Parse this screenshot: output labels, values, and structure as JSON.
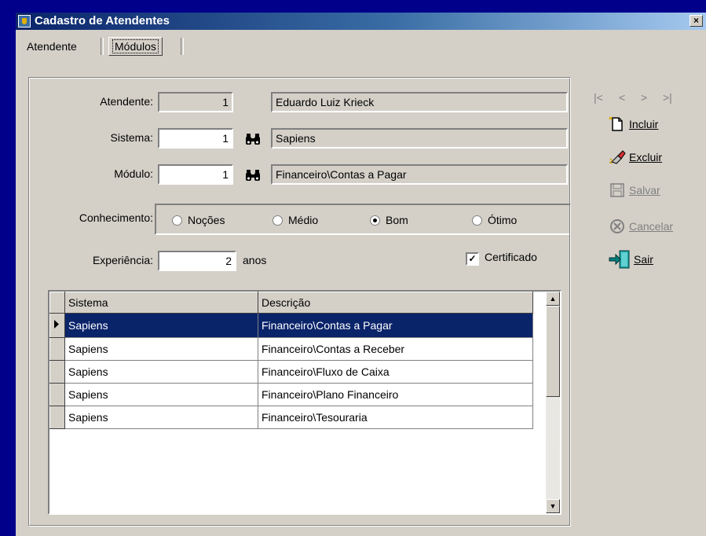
{
  "window": {
    "title": "Cadastro de Atendentes",
    "close_glyph": "×"
  },
  "tabs": [
    {
      "label": "Atendente",
      "active": false
    },
    {
      "label": "Módulos",
      "active": true
    }
  ],
  "form": {
    "atendente_label": "Atendente:",
    "atendente_code": "1",
    "atendente_name": "Eduardo Luiz Krieck",
    "sistema_label": "Sistema:",
    "sistema_code": "1",
    "sistema_name": "Sapiens",
    "modulo_label": "Módulo:",
    "modulo_code": "1",
    "modulo_name": "Financeiro\\Contas a Pagar",
    "conhecimento_label": "Conhecimento:",
    "conhecimento_options": [
      "Noções",
      "Médio",
      "Bom",
      "Ótimo"
    ],
    "conhecimento_selected": "Bom",
    "experiencia_label": "Experiência:",
    "experiencia_value": "2",
    "experiencia_unit": "anos",
    "certificado_label": "Certificado",
    "certificado_checked": true
  },
  "grid": {
    "headers": [
      "Sistema",
      "Descrição"
    ],
    "rows": [
      {
        "sistema": "Sapiens",
        "descricao": "Financeiro\\Contas a Pagar",
        "selected": true
      },
      {
        "sistema": "Sapiens",
        "descricao": "Financeiro\\Contas a Receber"
      },
      {
        "sistema": "Sapiens",
        "descricao": "Financeiro\\Fluxo de Caixa"
      },
      {
        "sistema": "Sapiens",
        "descricao": "Financeiro\\Plano Financeiro"
      },
      {
        "sistema": "Sapiens",
        "descricao": "Financeiro\\Tesouraria"
      }
    ]
  },
  "navigator": {
    "first": "|<",
    "prev": "<",
    "next": ">",
    "last": ">|"
  },
  "actions": {
    "incluir": {
      "label": "Incluir",
      "icon": "new-document-icon",
      "enabled": true
    },
    "excluir": {
      "label": "Excluir",
      "icon": "eraser-icon",
      "enabled": true
    },
    "salvar": {
      "label": "Salvar",
      "icon": "floppy-disk-icon",
      "enabled": false
    },
    "cancelar": {
      "label": "Cancelar",
      "icon": "cancel-icon",
      "enabled": false
    },
    "sair": {
      "label": "Sair",
      "icon": "exit-door-icon",
      "enabled": true
    }
  }
}
